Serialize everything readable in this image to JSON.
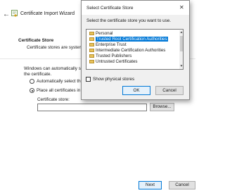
{
  "wizard": {
    "title": "Certificate Import Wizard",
    "section_title": "Certificate Store",
    "section_desc": "Certificate stores are system are",
    "auto_text_line1": "Windows can automatically selec",
    "auto_text_line2": "the certificate.",
    "option_auto": "Automatically select the c",
    "option_place": "Place all certificates in the",
    "selected_option": "place",
    "store_label": "Certificate store:",
    "store_value": "",
    "browse_label": "Browse...",
    "next_label": "Next",
    "cancel_label": "Cancel"
  },
  "dialog": {
    "title": "Select Certificate Store",
    "close_icon": "close-icon",
    "instruction": "Select the certificate store you want to use.",
    "stores": [
      {
        "label": "Personal",
        "selected": false
      },
      {
        "label": "Trusted Root Certification Authorities",
        "selected": true
      },
      {
        "label": "Enterprise Trust",
        "selected": false
      },
      {
        "label": "Intermediate Certification Authorities",
        "selected": false
      },
      {
        "label": "Trusted Publishers",
        "selected": false
      },
      {
        "label": "Untrusted Certificates",
        "selected": false
      }
    ],
    "show_physical_label": "Show physical stores",
    "show_physical_checked": false,
    "ok_label": "OK",
    "cancel_label": "Cancel"
  },
  "colors": {
    "accent": "#0078d7",
    "folder": "#e8c25a"
  }
}
